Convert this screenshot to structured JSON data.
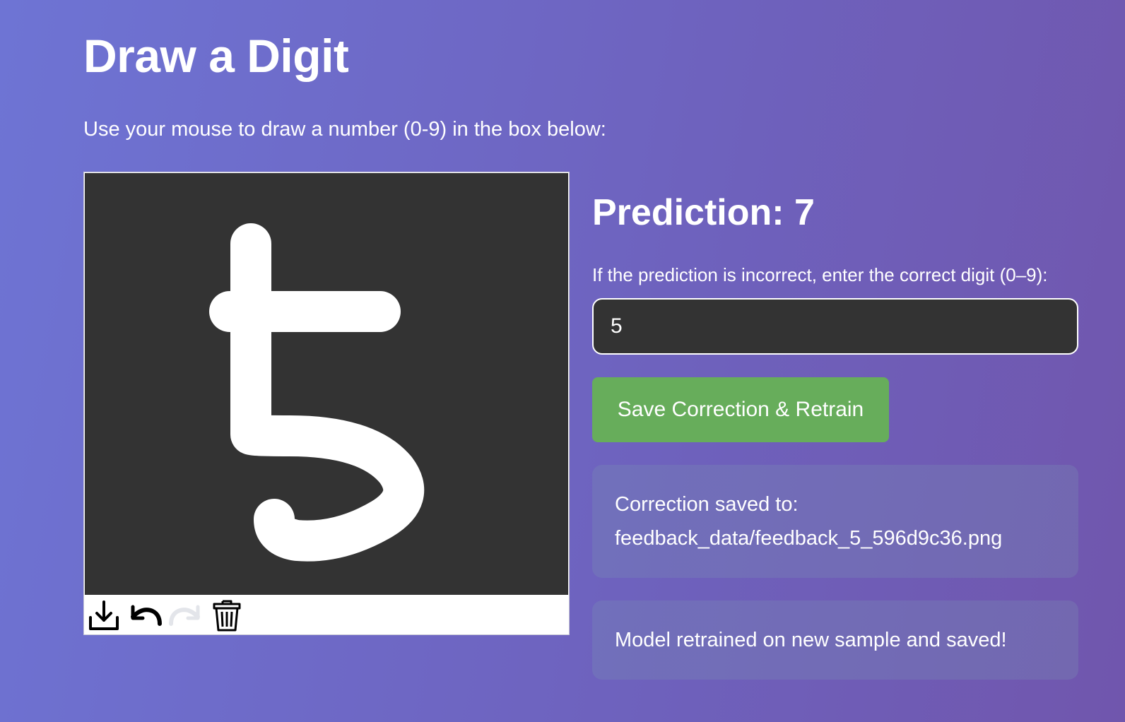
{
  "page": {
    "title": "Draw a Digit",
    "instructions": "Use your mouse to draw a number (0-9) in the box below:"
  },
  "canvas": {
    "background_color": "#333333",
    "stroke_color": "#ffffff",
    "toolbar": {
      "download_icon": "download-icon",
      "undo_icon": "undo-icon",
      "redo_icon": "redo-icon",
      "delete_icon": "trash-icon"
    }
  },
  "prediction": {
    "heading": "Prediction: 7"
  },
  "correction": {
    "label": "If the prediction is incorrect, enter the correct digit (0–9):",
    "value": "5",
    "button_label": "Save Correction & Retrain",
    "button_color": "#67ad5b"
  },
  "messages": {
    "saved_line1": "Correction saved to:",
    "saved_line2": "feedback_data/feedback_5_596d9c36.png",
    "retrained": "Model retrained on new sample and saved!"
  }
}
